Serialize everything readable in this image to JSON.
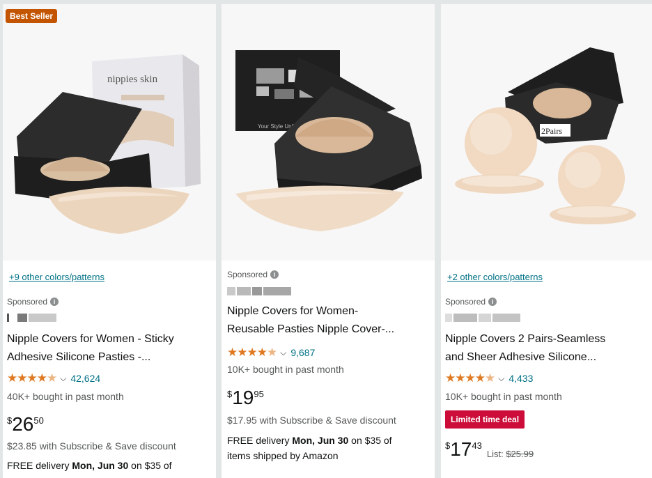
{
  "cards": [
    {
      "badge": "Best Seller",
      "colors_link": "+9 other colors/patterns",
      "sponsored": "Sponsored",
      "title_line1": "Nipple Covers for Women - Sticky",
      "title_line2": "Adhesive Silicone Pasties -...",
      "rating_stars": 4.5,
      "rating_count": "42,624",
      "bought": "40K+ bought in past month",
      "price_symbol": "$",
      "price_whole": "26",
      "price_fraction": "50",
      "subscribe_save": "$23.85 with Subscribe & Save discount",
      "delivery_prefix": "FREE delivery",
      "delivery_date": "Mon, Jun 30",
      "delivery_suffix": "on $35 of",
      "box_label": "nippies skin"
    },
    {
      "sponsored": "Sponsored",
      "title_line1": "Nipple Covers for Women-",
      "title_line2": "Reusable Pasties Nipple Cover-...",
      "rating_stars": 4.5,
      "rating_count": "9,687",
      "bought": "10K+ bought in past month",
      "price_symbol": "$",
      "price_whole": "19",
      "price_fraction": "95",
      "subscribe_save": "$17.95 with Subscribe & Save discount",
      "delivery_prefix": "FREE delivery",
      "delivery_date": "Mon, Jun 30",
      "delivery_suffix": "on $35 of",
      "delivery_line2": "items shipped by Amazon",
      "box_label": "Your Style Unlimited"
    },
    {
      "colors_link": "+2 other colors/patterns",
      "sponsored": "Sponsored",
      "title_line1": "Nipple Covers 2 Pairs-Seamless",
      "title_line2": "and Sheer Adhesive Silicone...",
      "rating_stars": 4.5,
      "rating_count": "4,433",
      "bought": "10K+ bought in past month",
      "deal": "Limited time deal",
      "price_symbol": "$",
      "price_whole": "17",
      "price_fraction": "43",
      "list_label": "List:",
      "list_price": "$25.99",
      "box_label": "2Pairs"
    }
  ],
  "colors": {
    "link": "#007185",
    "star": "#de7921",
    "best_seller": "#c45500",
    "deal": "#cc0c39"
  }
}
